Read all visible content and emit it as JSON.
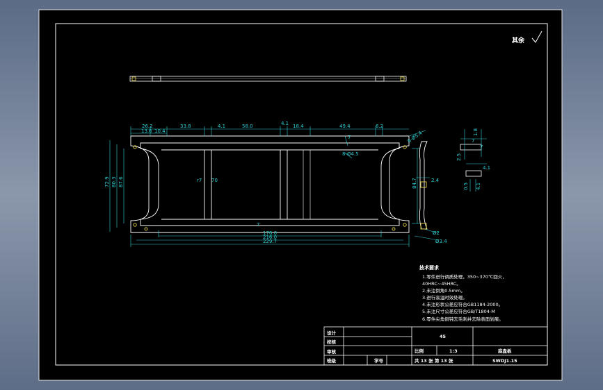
{
  "dims": {
    "top_row": [
      "26.2",
      "13.6",
      "10.4",
      "33.8",
      "4.1",
      "58.0",
      "4.1",
      "18.4",
      "49.4",
      "6.2"
    ],
    "bottom_row": [
      "176.0",
      "216.0",
      "229.7"
    ],
    "left_side": [
      "72.9",
      "80.3",
      "87.6"
    ],
    "right_side": "84.7",
    "small": [
      "2.4",
      "Ø2",
      "Ø3.4"
    ],
    "inner": [
      "r7",
      "70",
      "7",
      "7",
      "6-Ø5.4",
      "8-Ø4.5"
    ],
    "section": [
      "1.8",
      "7",
      "7",
      "2.5",
      "4.1",
      "0.5",
      "4.1"
    ]
  },
  "roughness": "其余",
  "tech": {
    "title": "技术要求",
    "lines": [
      "1.零件进行调质处理，350~370℃回火，",
      "  40HRC~45HRC。",
      "2.未注倒角0.5mm。",
      "3.进行高温时效处理。",
      "4.未注形状公差应符合GB1184-2000。",
      "5.未注尺寸公差应符合GB/T1804-M",
      "6.零件尖角倒钝去毛刺并去除表面划痕。"
    ]
  },
  "title_block": {
    "material": "45",
    "scale_label": "比例",
    "scale": "1:3",
    "part_name": "底盘板",
    "sheets": "共 13 张  第 13 张",
    "drawing_no": "SWDJ1.15",
    "roles": [
      "设计",
      "校核",
      "审核",
      "班级"
    ],
    "id_label": "学号"
  }
}
